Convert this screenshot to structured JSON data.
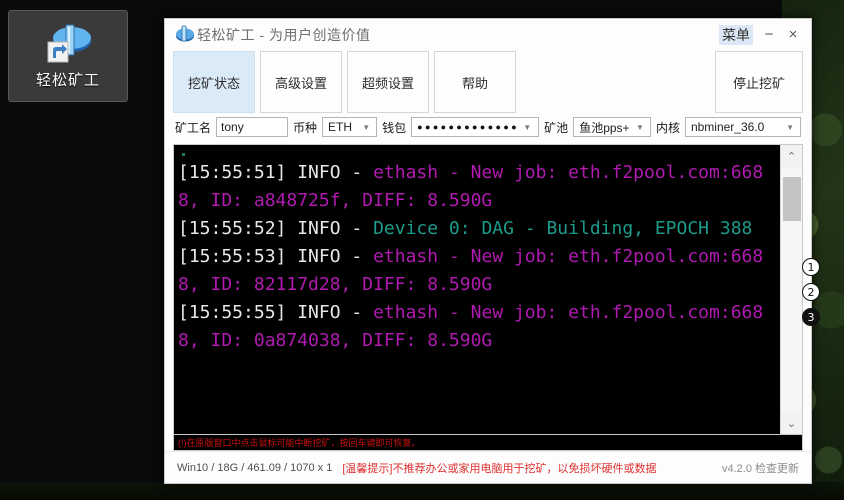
{
  "desktop": {
    "shortcut": {
      "label": "轻松矿工",
      "icon": "mining-app-shortcut-icon"
    }
  },
  "window": {
    "title": "轻松矿工 - 为用户创造价值",
    "logo_icon": "app-logo-icon",
    "controls": {
      "menu_label": "菜单",
      "minimize_label": "−",
      "close_label": "×"
    },
    "tabs": [
      {
        "label": "挖矿状态",
        "active": true
      },
      {
        "label": "高级设置",
        "active": false
      },
      {
        "label": "超频设置",
        "active": false
      },
      {
        "label": "帮助",
        "active": false
      }
    ],
    "stop_button": "停止挖矿",
    "form": {
      "miner_name": {
        "label": "矿工名",
        "value": "tony",
        "placeholder": ""
      },
      "coin": {
        "label": "币种",
        "value": "ETH",
        "arrow_icon": "chevron-down-icon"
      },
      "wallet": {
        "label": "钱包",
        "value": "●●●●●●●●●●●●●",
        "arrow_icon": "chevron-down-icon"
      },
      "pool": {
        "label": "矿池",
        "value": "鱼池pps+",
        "arrow_icon": "chevron-down-icon"
      },
      "kernel": {
        "label": "内核",
        "value": "nbminer_36.0",
        "arrow_icon": "chevron-down-icon"
      }
    },
    "console": {
      "lines": [
        {
          "ts": "[15:55:51] INFO - ",
          "body": "ethash - New job: eth.f2pool.com:6688, ID: a848725f, DIFF: 8.590G",
          "color": "pink"
        },
        {
          "ts": "[15:55:52] INFO - ",
          "body": "Device 0: DAG - Building, EPOCH 388",
          "color": "teal"
        },
        {
          "ts": "[15:55:53] INFO - ",
          "body": "ethash - New job: eth.f2pool.com:6688, ID: 82117d28, DIFF: 8.590G",
          "color": "pink"
        },
        {
          "ts": "[15:55:55] INFO - ",
          "body": "ethash - New job: eth.f2pool.com:6688, ID: 0a874038, DIFF: 8.590G",
          "color": "pink"
        }
      ],
      "scrollbar": {
        "up_icon": "chevron-up-icon",
        "down_icon": "chevron-down-icon"
      }
    },
    "red_note": "(!)在原版窗口中点击鼠标可能中断挖矿，按回车键即可恢复。",
    "statusbar": {
      "system_info": "Win10  / 18G / 461.09 / 1070 x 1",
      "warning": "[温馨提示]不推荐办公或家用电脑用于挖矿，以免损坏硬件或数据",
      "version": "v4.2.0 检查更新"
    }
  },
  "markers": [
    {
      "label": "1",
      "filled": false
    },
    {
      "label": "2",
      "filled": false
    },
    {
      "label": "3",
      "filled": true
    }
  ],
  "colors": {
    "accent_tab": "#dbeaf7",
    "console_bg": "#000000",
    "log_pink": "#b01ab0",
    "log_teal": "#1c9a8a",
    "warning_red": "#e03030"
  }
}
